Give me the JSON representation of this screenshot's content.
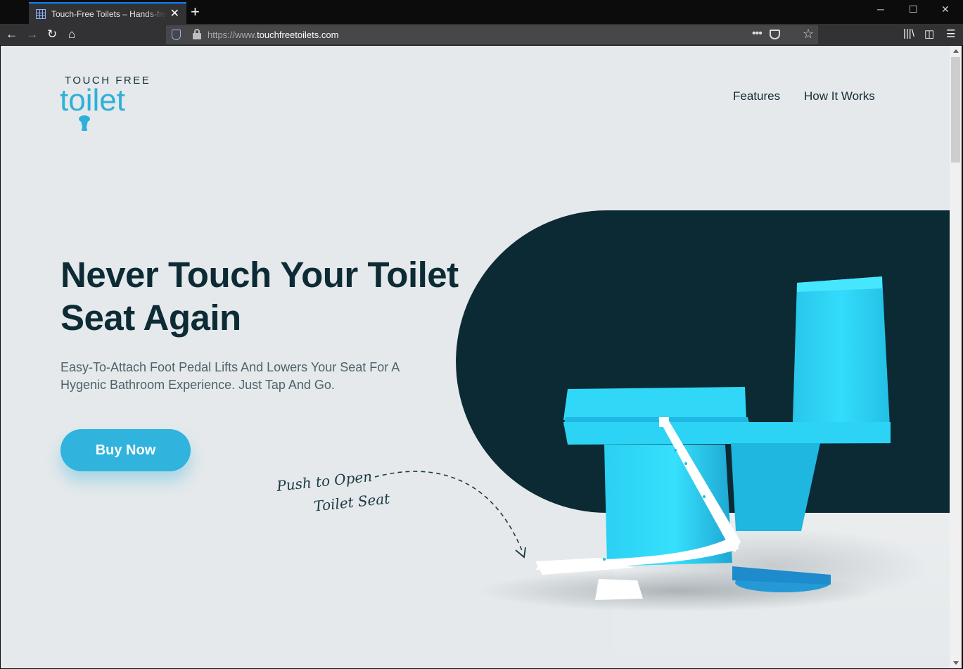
{
  "browser": {
    "tab_title": "Touch-Free Toilets – Hands-free",
    "url_prefix": "https://www.",
    "url_host": "touchfreetoilets.com"
  },
  "site": {
    "logo_top": "TOUCH FREE",
    "logo_word": "toilet",
    "nav": [
      {
        "label": "Features"
      },
      {
        "label": "How It Works"
      }
    ]
  },
  "hero": {
    "title_line1": "Never Touch Your Toilet",
    "title_line2": "Seat Again",
    "subtitle": "Easy-To-Attach Foot Pedal Lifts And Lowers Your Seat For A Hygenic Bathroom Experience. Just Tap And Go.",
    "cta_label": "Buy Now",
    "annotation_line1": "Push to Open",
    "annotation_line2": "Toilet Seat"
  },
  "colors": {
    "accent": "#30b3dc",
    "dark": "#0c2a34",
    "background": "#e5e9eb",
    "toilet": "#2ed8f7"
  }
}
